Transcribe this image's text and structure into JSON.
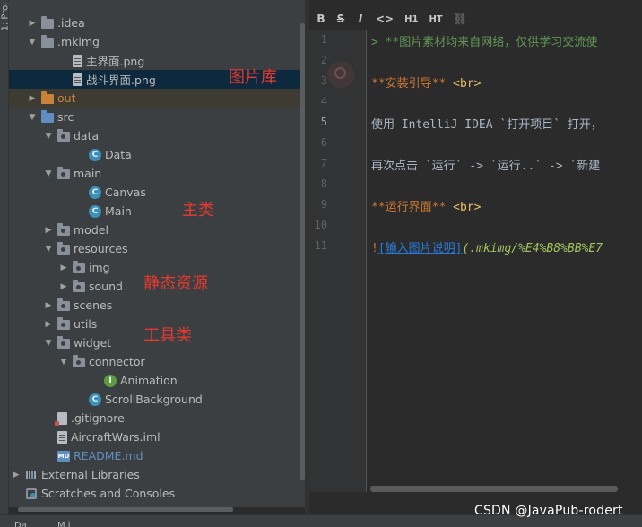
{
  "side_strip": {
    "label": "1: Proj"
  },
  "tree": {
    "items": [
      {
        "label": ".idea",
        "type": "folder",
        "expanded": false
      },
      {
        "label": ".mkimg",
        "type": "folder",
        "expanded": true
      },
      {
        "label": "主界面.png",
        "type": "file"
      },
      {
        "label": "战斗界面.png",
        "type": "file",
        "selected": true
      },
      {
        "label": "out",
        "type": "folder",
        "excluded": true
      },
      {
        "label": "src",
        "type": "folder",
        "expanded": true
      },
      {
        "label": "data",
        "type": "package",
        "expanded": true
      },
      {
        "label": "Data",
        "type": "class"
      },
      {
        "label": "main",
        "type": "package",
        "expanded": true
      },
      {
        "label": "Canvas",
        "type": "class"
      },
      {
        "label": "Main",
        "type": "class"
      },
      {
        "label": "model",
        "type": "package",
        "expanded": false
      },
      {
        "label": "resources",
        "type": "package",
        "expanded": true
      },
      {
        "label": "img",
        "type": "package",
        "expanded": false
      },
      {
        "label": "sound",
        "type": "package",
        "expanded": false
      },
      {
        "label": "scenes",
        "type": "package",
        "expanded": false
      },
      {
        "label": "utils",
        "type": "package",
        "expanded": false
      },
      {
        "label": "widget",
        "type": "package",
        "expanded": true
      },
      {
        "label": "connector",
        "type": "package",
        "expanded": true
      },
      {
        "label": "Animation",
        "type": "interface"
      },
      {
        "label": "ScrollBackground",
        "type": "class"
      },
      {
        "label": ".gitignore",
        "type": "gitfile"
      },
      {
        "label": "AircraftWars.iml",
        "type": "file"
      },
      {
        "label": "README.md",
        "type": "markdown"
      },
      {
        "label": "External Libraries",
        "type": "libraries",
        "expanded": false
      },
      {
        "label": "Scratches and Consoles",
        "type": "scratches"
      }
    ]
  },
  "annotations": {
    "image_lib": "图片库",
    "main_class": "主类",
    "static_resources": "静态资源",
    "tool_class": "工具类"
  },
  "editor": {
    "toolbar": {
      "bold": "B",
      "strike": "S",
      "italic": "I",
      "code": "<>",
      "h1": "H1",
      "ht": "HT",
      "link": "⛓"
    },
    "line_numbers": [
      "1",
      "2",
      "3",
      "4",
      "5",
      "6",
      "7",
      "8",
      "9",
      "10",
      "11"
    ],
    "active_line": "5",
    "lines": {
      "l1_quote": ">",
      "l1_text": " **图片素材均来自网络，仅供学习交流使",
      "l3_bold": "**安装引导**",
      "l3_tag": " <br>",
      "l5_text": "使用 IntelliJ IDEA `打开项目` 打开，",
      "l7_text": "再次点击 `运行` -> `运行..` -> `新建",
      "l9_bold": "**运行界面**",
      "l9_tag": " <br>",
      "l11_bang": "!",
      "l11_link": "[输入图片说明]",
      "l11_path": "(.mkimg/%E4%B8%BB%E7"
    }
  },
  "bottom_bar": {
    "tab1": "Da",
    "tab2": "M i"
  },
  "watermark": "CSDN @JavaPub-rodert",
  "colors": {
    "panel_bg": "#3c3f41",
    "editor_bg": "#2b2b2b",
    "selection": "#0d293e",
    "annotation_red": "#e8392f"
  }
}
